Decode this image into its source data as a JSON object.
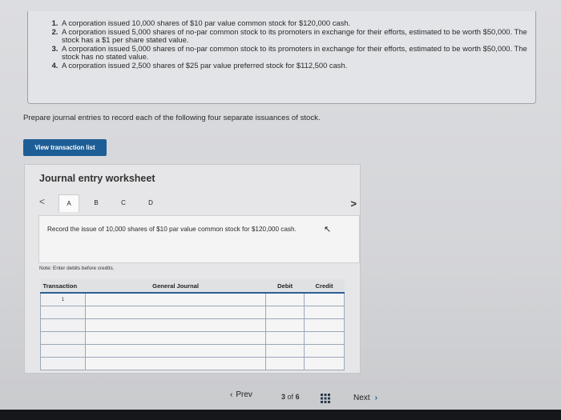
{
  "problem": {
    "items": [
      "A corporation issued 10,000 shares of $10 par value common stock for $120,000 cash.",
      "A corporation issued 5,000 shares of no-par common stock to its promoters in exchange for their efforts, estimated to be worth $50,000. The stock has a $1 per share stated value.",
      "A corporation issued 5,000 shares of no-par common stock to its promoters in exchange for their efforts, estimated to be worth $50,000. The stock has no stated value.",
      "A corporation issued 2,500 shares of $25 par value preferred stock for $112,500 cash."
    ]
  },
  "instruction": "Prepare journal entries to record each of the following four separate issuances of stock.",
  "view_button": "View transaction list",
  "worksheet": {
    "title": "Journal entry worksheet",
    "tabs": [
      "A",
      "B",
      "C",
      "D"
    ],
    "active_tab": "A",
    "description": "Record the issue of 10,000 shares of $10 par value common stock for $120,000 cash.",
    "note": "Note: Enter debits before credits.",
    "table": {
      "headers": {
        "transaction": "Transaction",
        "general_journal": "General Journal",
        "debit": "Debit",
        "credit": "Credit"
      },
      "first_row_number": "1",
      "rows": 6
    }
  },
  "footer": {
    "prev_label": "Prev",
    "page_current": "3",
    "page_of": "of",
    "page_total": "6",
    "next_label": "Next"
  },
  "colors": {
    "accent": "#1d5e97",
    "header_rule": "#2a5f95"
  }
}
